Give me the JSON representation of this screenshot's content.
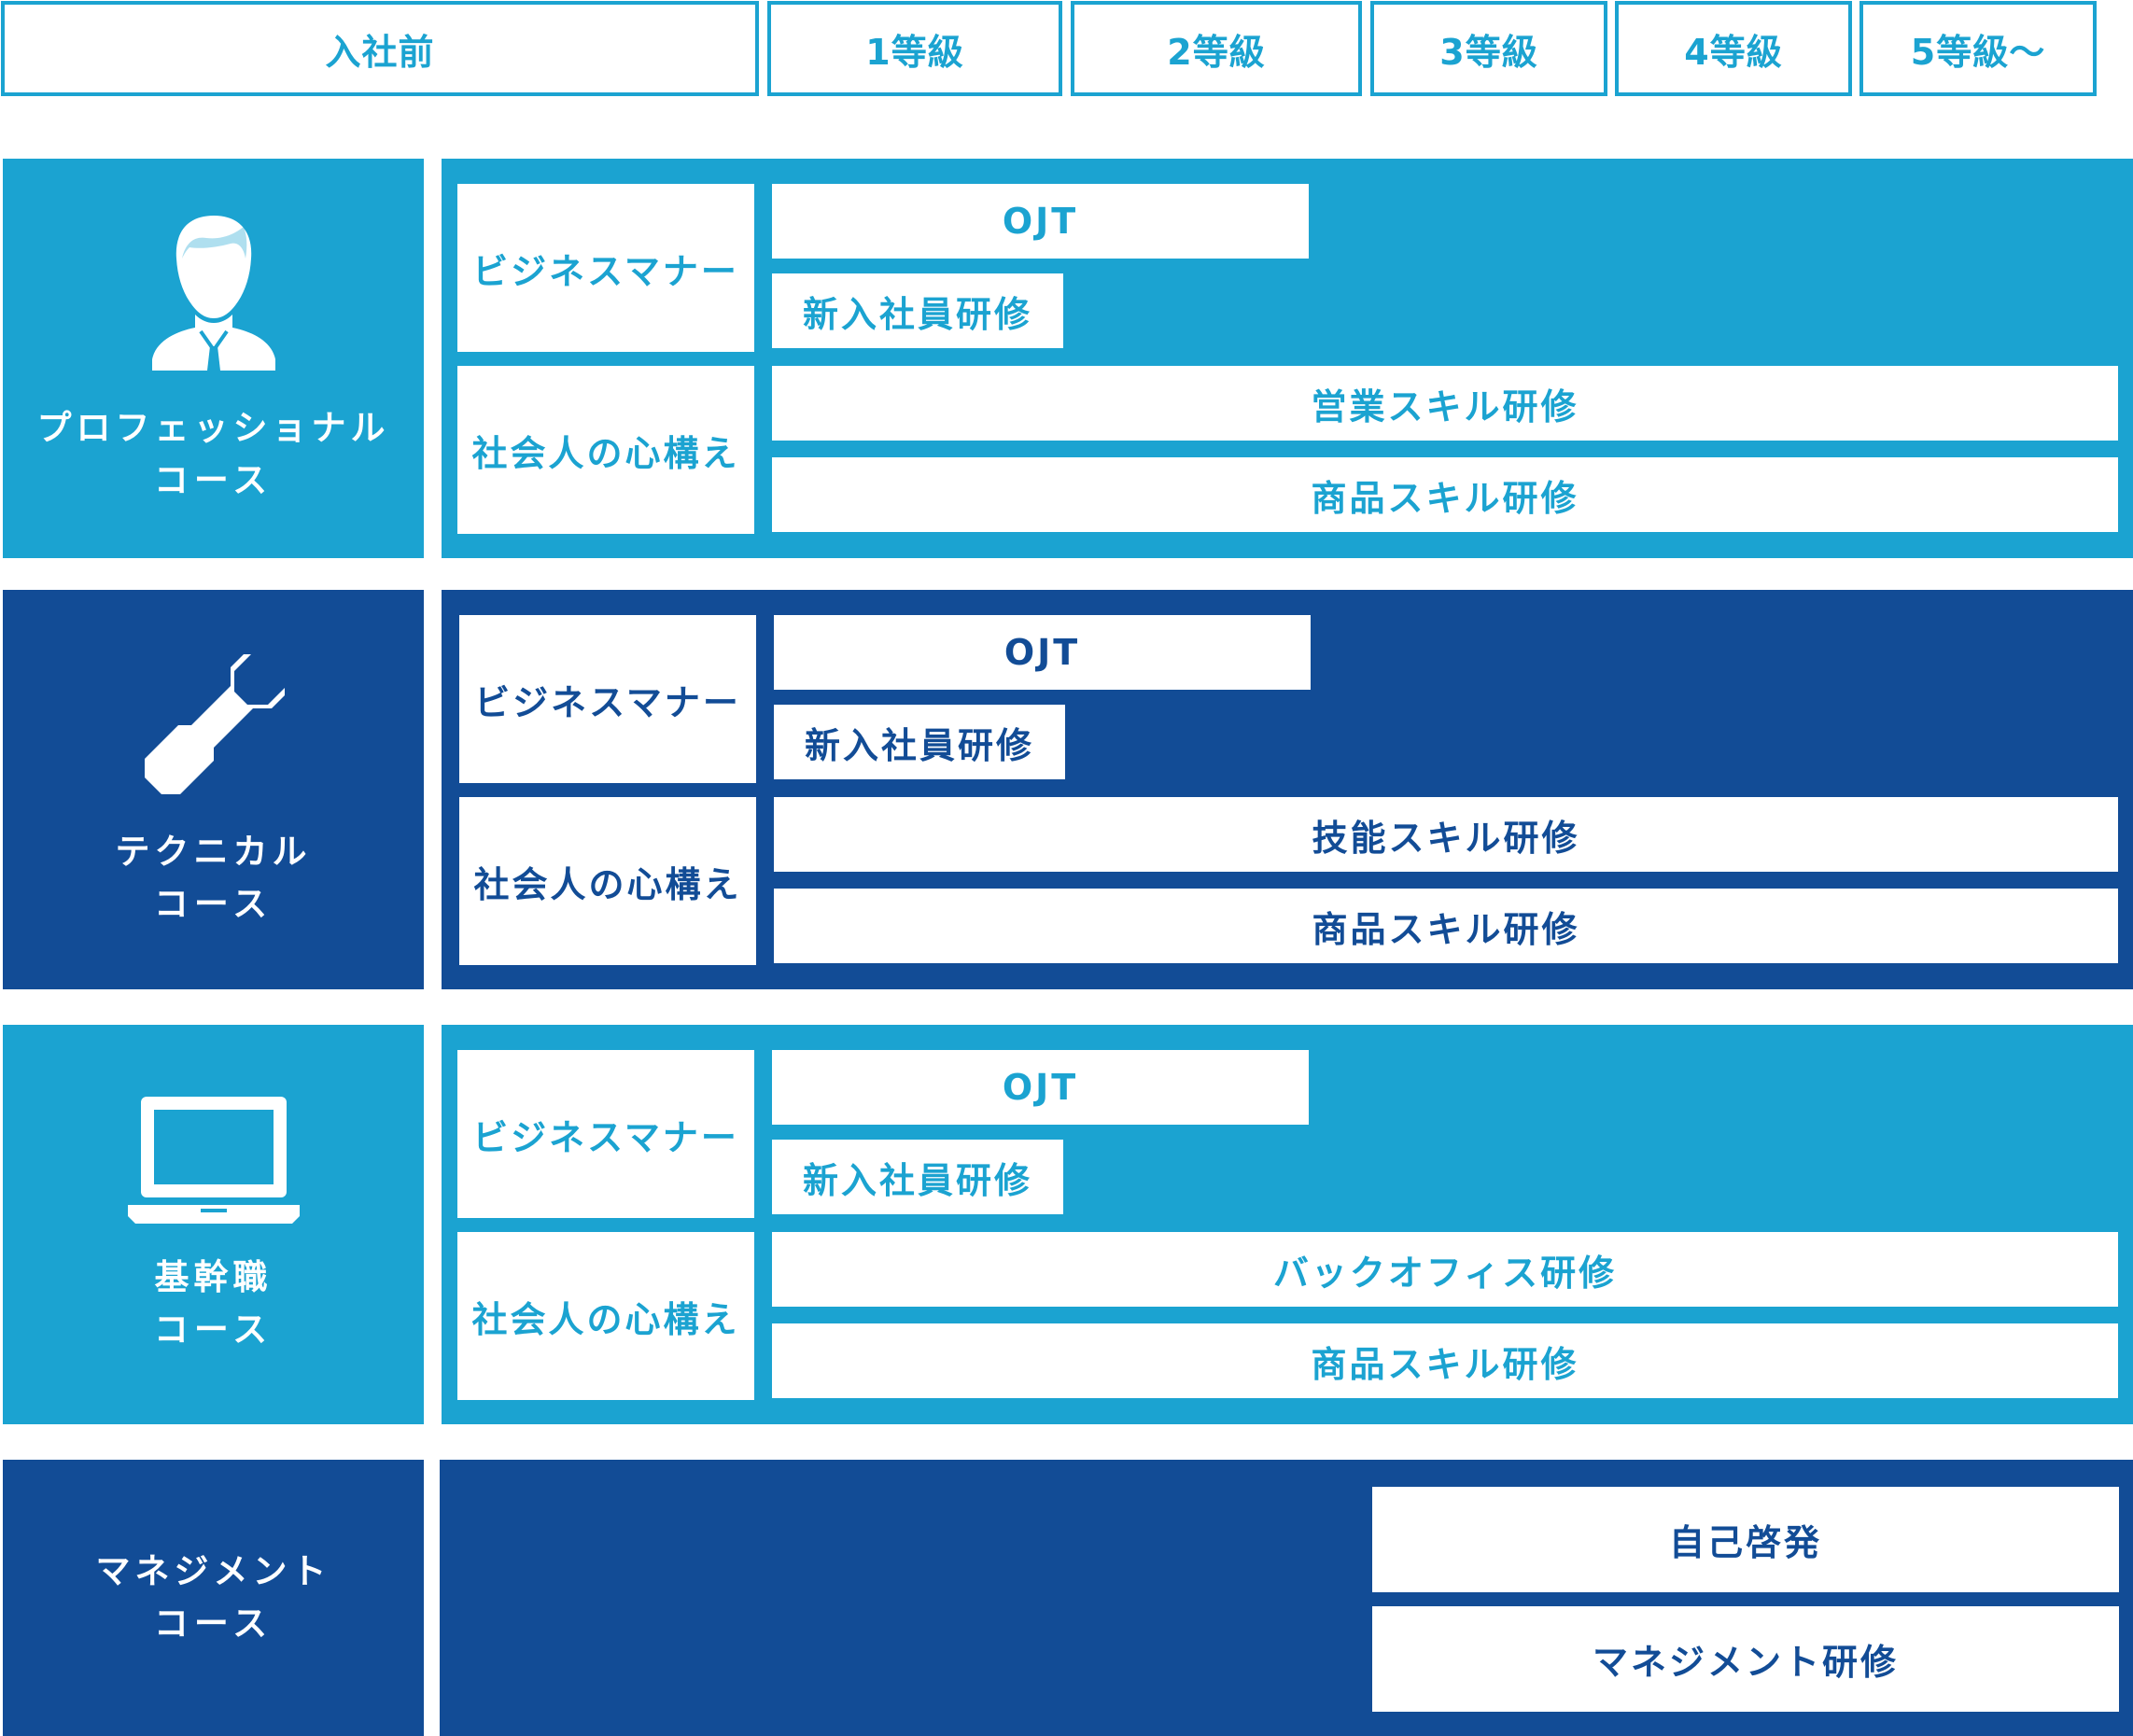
{
  "header": {
    "tabs": [
      "入社前",
      "1等級",
      "2等級",
      "3等級",
      "4等級",
      "5等級〜"
    ]
  },
  "colors": {
    "light": "#1ba3d1",
    "dark": "#124c96"
  },
  "courses": [
    {
      "icon": "person-icon",
      "name": "プロフェッショナル",
      "sub": "コース",
      "categories": [
        "ビジネスマナー",
        "社会人の心構え"
      ],
      "trainings": [
        "OJT",
        "新入社員研修",
        "営業スキル研修",
        "商品スキル研修"
      ]
    },
    {
      "icon": "wrench-icon",
      "name": "テクニカル",
      "sub": "コース",
      "categories": [
        "ビジネスマナー",
        "社会人の心構え"
      ],
      "trainings": [
        "OJT",
        "新入社員研修",
        "技能スキル研修",
        "商品スキル研修"
      ]
    },
    {
      "icon": "laptop-icon",
      "name": "基幹職",
      "sub": "コース",
      "categories": [
        "ビジネスマナー",
        "社会人の心構え"
      ],
      "trainings": [
        "OJT",
        "新入社員研修",
        "バックオフィス研修",
        "商品スキル研修"
      ]
    },
    {
      "name": "マネジメント",
      "sub": "コース",
      "trainings": [
        "自己啓発",
        "マネジメント研修"
      ]
    }
  ]
}
